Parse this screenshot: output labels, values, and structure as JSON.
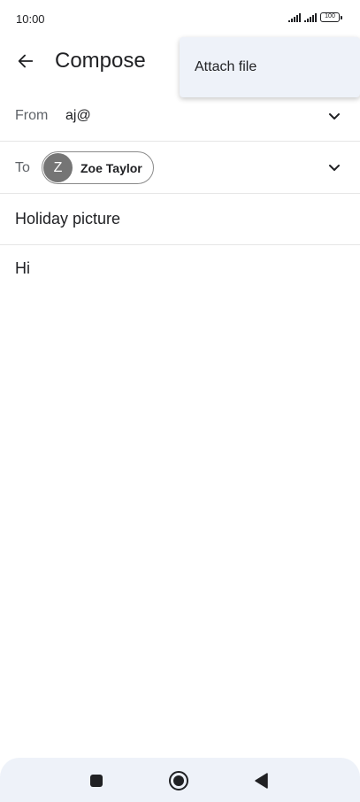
{
  "status_bar": {
    "time": "10:00",
    "battery": "100"
  },
  "app_bar": {
    "title": "Compose",
    "back_icon": "arrow-left-icon"
  },
  "menu": {
    "items": [
      {
        "label": "Attach file"
      }
    ]
  },
  "compose": {
    "from": {
      "label": "From",
      "value": "aj@"
    },
    "to": {
      "label": "To",
      "recipient": {
        "initial": "Z",
        "name": "Zoe Taylor"
      }
    },
    "subject": "Holiday picture",
    "body": "Hi"
  },
  "nav_bar": {
    "icons": [
      "recents-square-icon",
      "home-circle-icon",
      "back-triangle-icon"
    ]
  },
  "colors": {
    "menu_background": "#eef2f9",
    "avatar": "#757575",
    "text_primary": "#202124",
    "text_secondary": "#5f6368"
  }
}
